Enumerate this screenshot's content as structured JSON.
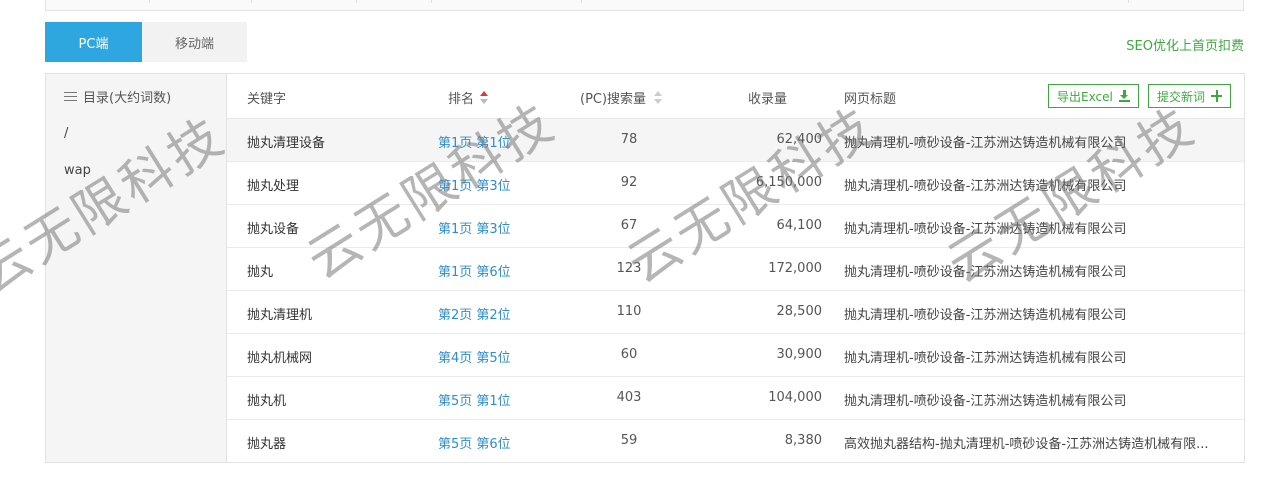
{
  "tabs": [
    {
      "label": "PC端"
    },
    {
      "label": "移动端"
    }
  ],
  "seo_link": "SEO优化上首页扣费",
  "sidebar": {
    "header": "目录(大约词数)",
    "items": [
      {
        "label": "/"
      },
      {
        "label": "wap"
      }
    ]
  },
  "table": {
    "headers": {
      "keyword": "关键字",
      "rank": "排名",
      "pc_search": "(PC)搜索量",
      "indexed": "收录量",
      "page_title": "网页标题"
    },
    "export_label": "导出Excel",
    "submit_label": "提交新词",
    "rows": [
      {
        "keyword": "抛丸清理设备",
        "rank": "第1页 第1位",
        "pc_search": "78",
        "indexed": "62,400",
        "title": "抛丸清理机-喷砂设备-江苏洲达铸造机械有限公司"
      },
      {
        "keyword": "抛丸处理",
        "rank": "第1页 第3位",
        "pc_search": "92",
        "indexed": "6,150,000",
        "title": "抛丸清理机-喷砂设备-江苏洲达铸造机械有限公司"
      },
      {
        "keyword": "抛丸设备",
        "rank": "第1页 第3位",
        "pc_search": "67",
        "indexed": "64,100",
        "title": "抛丸清理机-喷砂设备-江苏洲达铸造机械有限公司"
      },
      {
        "keyword": "抛丸",
        "rank": "第1页 第6位",
        "pc_search": "123",
        "indexed": "172,000",
        "title": "抛丸清理机-喷砂设备-江苏洲达铸造机械有限公司"
      },
      {
        "keyword": "抛丸清理机",
        "rank": "第2页 第2位",
        "pc_search": "110",
        "indexed": "28,500",
        "title": "抛丸清理机-喷砂设备-江苏洲达铸造机械有限公司"
      },
      {
        "keyword": "抛丸机械网",
        "rank": "第4页 第5位",
        "pc_search": "60",
        "indexed": "30,900",
        "title": "抛丸清理机-喷砂设备-江苏洲达铸造机械有限公司"
      },
      {
        "keyword": "抛丸机",
        "rank": "第5页 第1位",
        "pc_search": "403",
        "indexed": "104,000",
        "title": "抛丸清理机-喷砂设备-江苏洲达铸造机械有限公司"
      },
      {
        "keyword": "抛丸器",
        "rank": "第5页 第6位",
        "pc_search": "59",
        "indexed": "8,380",
        "title": "高效抛丸器结构-抛丸清理机-喷砂设备-江苏洲达铸造机械有限..."
      }
    ]
  },
  "watermark_text": "云无限科技",
  "colors": {
    "accent": "#2ea7e0",
    "green": "#3ea83e",
    "link": "#2e8dcc",
    "sort_active": "#e0353d"
  }
}
